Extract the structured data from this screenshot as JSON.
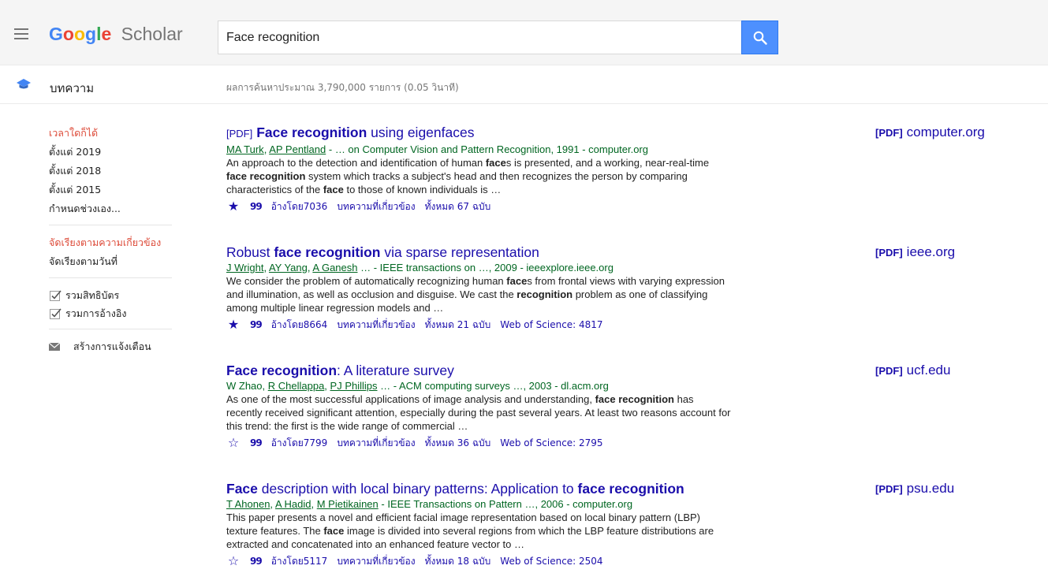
{
  "header": {
    "logo_letters": [
      "G",
      "o",
      "o",
      "g",
      "l",
      "e"
    ],
    "logo_suffix": "Scholar",
    "search_value": "Face recognition"
  },
  "subheader": {
    "section_label": "บทความ",
    "stats_text": "ผลการค้นหาประมาณ 3,790,000 รายการ (0.05 วินาที)"
  },
  "sidebar": {
    "time_filters": [
      "เวลาใดก็ได้",
      "ตั้งแต่ 2019",
      "ตั้งแต่ 2018",
      "ตั้งแต่ 2015",
      "กำหนดช่วงเอง..."
    ],
    "sort_relevance": "จัดเรียงตามความเกี่ยวข้อง",
    "sort_date": "จัดเรียงตามวันที่",
    "include_patents": "รวมสิทธิบัตร",
    "include_citations": "รวมการอ้างอิง",
    "create_alert": "สร้างการแจ้งเตือน"
  },
  "results": [
    {
      "tag": "[PDF]",
      "title_parts": [
        {
          "t": "Face recognition",
          "b": true
        },
        {
          "t": " using eigenfaces",
          "b": false
        }
      ],
      "meta_authors": [
        "MA Turk",
        "AP Pentland"
      ],
      "meta_rest": "- … on Computer Vision and Pattern Recognition, 1991 - computer.org",
      "snippet": "An approach to the detection and identification of human faces is presented, and a working, near-real-time face recognition system which tracks a subject's head and then recognizes the person by comparing characteristics of the face to those of known individuals is …",
      "starred": true,
      "cite_symbol": "99",
      "cited_by": "อ้างโดย7036",
      "related": "บทความที่เกี่ยวข้อง",
      "versions": "ทั้งหมด 67 ฉบับ",
      "wos": "",
      "side_tag": "[PDF]",
      "side_domain": "computer.org"
    },
    {
      "tag": "",
      "title_parts": [
        {
          "t": "Robust ",
          "b": false
        },
        {
          "t": "face recognition",
          "b": true
        },
        {
          "t": " via sparse representation",
          "b": false
        }
      ],
      "meta_authors": [
        "J Wright",
        "AY Yang",
        "A Ganesh"
      ],
      "meta_rest": "… - IEEE transactions on …, 2009 - ieeexplore.ieee.org",
      "snippet": "We consider the problem of automatically recognizing human faces from frontal views with varying expression and illumination, as well as occlusion and disguise. We cast the recognition problem as one of classifying among multiple linear regression models and …",
      "starred": true,
      "cite_symbol": "99",
      "cited_by": "อ้างโดย8664",
      "related": "บทความที่เกี่ยวข้อง",
      "versions": "ทั้งหมด 21 ฉบับ",
      "wos": "Web of Science: 4817",
      "side_tag": "[PDF]",
      "side_domain": "ieee.org"
    },
    {
      "tag": "",
      "title_parts": [
        {
          "t": "Face recognition",
          "b": true
        },
        {
          "t": ": A literature survey",
          "b": false
        }
      ],
      "meta_plain": "W Zhao, ",
      "meta_authors": [
        "R Chellappa",
        "PJ Phillips"
      ],
      "meta_rest": "… - ACM computing surveys …, 2003 - dl.acm.org",
      "snippet": "As one of the most successful applications of image analysis and understanding, face recognition has recently received significant attention, especially during the past several years. At least two reasons account for this trend: the first is the wide range of commercial …",
      "starred": false,
      "cite_symbol": "99",
      "cited_by": "อ้างโดย7799",
      "related": "บทความที่เกี่ยวข้อง",
      "versions": "ทั้งหมด 36 ฉบับ",
      "wos": "Web of Science: 2795",
      "side_tag": "[PDF]",
      "side_domain": "ucf.edu"
    },
    {
      "tag": "",
      "title_parts": [
        {
          "t": "Face",
          "b": true
        },
        {
          "t": " description with local binary patterns: Application to ",
          "b": false
        },
        {
          "t": "face recognition",
          "b": true
        }
      ],
      "meta_authors": [
        "T Ahonen",
        "A Hadid",
        "M Pietikainen"
      ],
      "meta_rest": "- IEEE Transactions on Pattern …, 2006 - computer.org",
      "snippet": "This paper presents a novel and efficient facial image representation based on local binary pattern (LBP) texture features. The face image is divided into several regions from which the LBP feature distributions are extracted and concatenated into an enhanced feature vector to …",
      "starred": false,
      "cite_symbol": "99",
      "cited_by": "อ้างโดย5117",
      "related": "บทความที่เกี่ยวข้อง",
      "versions": "ทั้งหมด 18 ฉบับ",
      "wos": "Web of Science: 2504",
      "side_tag": "[PDF]",
      "side_domain": "psu.edu"
    }
  ],
  "snippet_bold_words": [
    "face recognition",
    "recognition",
    "face"
  ],
  "colors": {
    "link": "#1a0dab",
    "meta": "#006621",
    "accent_red": "#dd4b39",
    "search_button": "#4d90fe"
  }
}
